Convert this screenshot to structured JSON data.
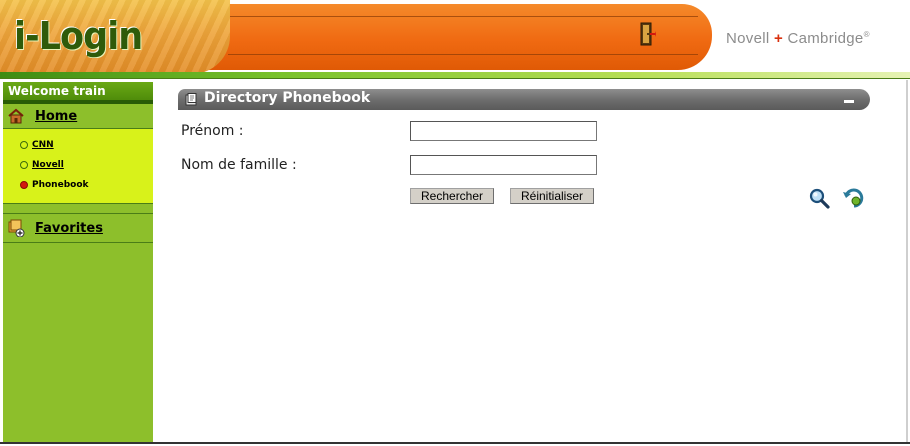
{
  "header": {
    "logo_text": "i-Login",
    "brand_left": "Novell",
    "brand_plus": "+",
    "brand_right": "Cambridge",
    "brand_mark": "®",
    "exit_icon": "exit-door-icon",
    "colors": {
      "orange": "#f06a12",
      "logo_green": "#2f5b0a",
      "plus_red": "#d9310f"
    }
  },
  "sidebar": {
    "welcome": "Welcome train",
    "home": {
      "label": "Home",
      "icon": "home-icon"
    },
    "items": [
      {
        "label": "CNN",
        "link": true,
        "active": false
      },
      {
        "label": "Novell",
        "link": true,
        "active": false
      },
      {
        "label": "Phonebook",
        "link": false,
        "active": true
      }
    ],
    "favorites": {
      "label": "Favorites",
      "icon": "favorites-icon"
    },
    "colors": {
      "sidebar_green": "#8dbf2b",
      "submenu_yellow": "#d8f21a"
    }
  },
  "panel": {
    "title": "Directory Phonebook",
    "icon": "phonebook-icon",
    "minimize_icon": "minimize-icon"
  },
  "form": {
    "prenom_label": "Prénom :",
    "prenom_value": "",
    "nom_label": "Nom de famille :",
    "nom_value": "",
    "search_button": "Rechercher",
    "reset_button": "Réinitialiser",
    "search_icon": "magnifier-icon",
    "refresh_icon": "refresh-icon"
  }
}
